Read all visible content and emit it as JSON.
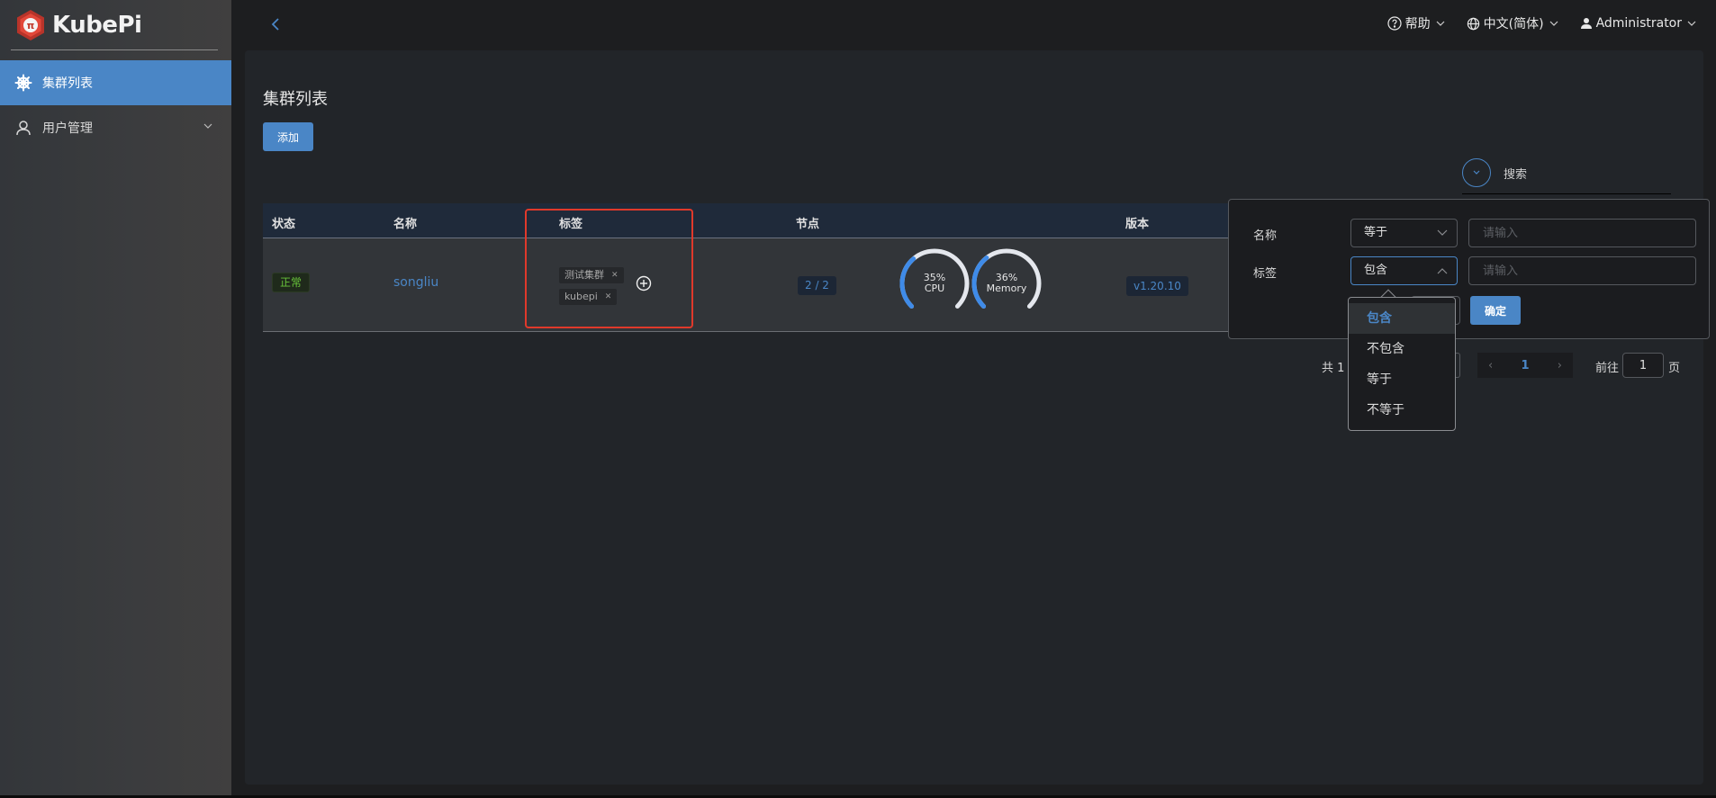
{
  "app": {
    "name": "KubePi"
  },
  "sidebar": {
    "items": [
      {
        "label": "集群列表",
        "icon": "kubernetes-wheel-icon",
        "active": true
      },
      {
        "label": "用户管理",
        "icon": "user-icon",
        "expandable": true
      }
    ]
  },
  "topbar": {
    "help": "帮助",
    "language": "中文(简体)",
    "user": "Administrator"
  },
  "page": {
    "title": "集群列表",
    "add_button": "添加",
    "search_label": "搜索"
  },
  "table": {
    "columns": [
      "状态",
      "名称",
      "标签",
      "节点",
      "版本"
    ],
    "rows": [
      {
        "status": "正常",
        "name": "songliu",
        "labels": [
          "测试集群",
          "kubepi"
        ],
        "nodes": "2 / 2",
        "cpu": {
          "percent": 35,
          "text": "35%",
          "label": "CPU"
        },
        "memory": {
          "percent": 36,
          "text": "36%",
          "label": "Memory"
        },
        "version": "v1.20.10"
      }
    ]
  },
  "pagination": {
    "total": "共 1 条",
    "current_page": "1",
    "goto_label": "前往",
    "goto_value": "1",
    "goto_suffix": "页"
  },
  "filter": {
    "name_label": "名称",
    "name_operator": "等于",
    "name_placeholder": "请输入",
    "label_label": "标签",
    "label_operator": "包含",
    "label_placeholder": "请输入",
    "confirm": "确定",
    "operator_options": [
      "包含",
      "不包含",
      "等于",
      "不等于"
    ],
    "selected_option": "包含"
  },
  "colors": {
    "accent": "#4a86c6",
    "success": "#67c23a",
    "highlight": "#e0392b"
  }
}
